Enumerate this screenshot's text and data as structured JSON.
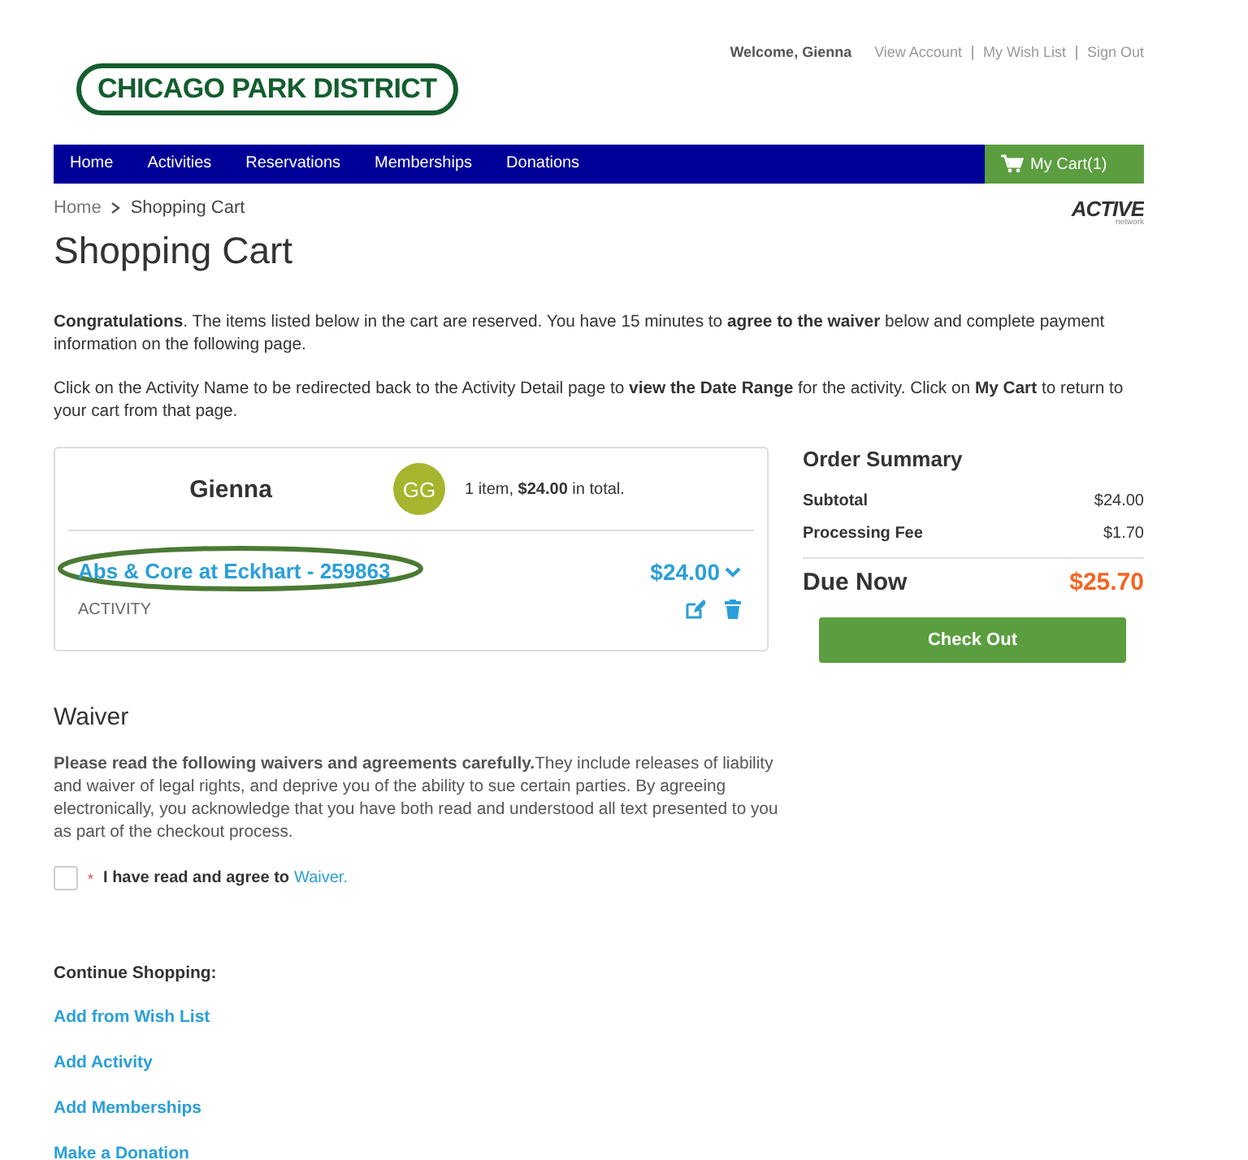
{
  "header": {
    "logo": "CHICAGO PARK DISTRICT",
    "welcome": "Welcome, Gienna",
    "links": [
      "View Account",
      "My Wish List",
      "Sign Out"
    ]
  },
  "nav": {
    "items": [
      "Home",
      "Activities",
      "Reservations",
      "Memberships",
      "Donations"
    ],
    "cart": "My Cart(1)"
  },
  "breadcrumb": [
    "Home",
    "Shopping Cart"
  ],
  "brand": {
    "name": "ACTIVE",
    "sub": "network"
  },
  "title": "Shopping Cart",
  "intro": [
    "**Congratulations**. The items listed below in the cart are reserved. You have 15 minutes to **agree to the waiver** below and complete payment information on the following page.",
    "Click on the Activity Name to be redirected back to the Activity Detail page to **view the Date Range** for the activity. Click on **My Cart** to return to your cart from that page."
  ],
  "cart": {
    "person": "Gienna",
    "initials": "GG",
    "summary": "1 item, **$24.00** in total.",
    "items": [
      {
        "name": "Abs & Core at Eckhart - 259863",
        "price": "$24.00",
        "type": "ACTIVITY",
        "highlighted": true
      }
    ]
  },
  "order_summary": {
    "title": "Order Summary",
    "lines": [
      {
        "label": "Subtotal",
        "value": "$24.00"
      },
      {
        "label": "Processing Fee",
        "value": "$1.70"
      }
    ],
    "due_label": "Due Now",
    "due_value": "$25.70",
    "button": "Check Out"
  },
  "waiver": {
    "title": "Waiver",
    "text": "**Please read the following waivers and agreements carefully.**They include releases of liability and waiver of legal rights, and deprive you of the ability to sue certain parties. By agreeing electronically, you acknowledge that you have both read and understood all text presented to you as part of the checkout process.",
    "required_mark": "*",
    "agree_label": "I have read and agree to",
    "agree_link": "Waiver.",
    "checked": false
  },
  "continue": {
    "title": "Continue Shopping:",
    "links": [
      "Add from Wish List",
      "Add Activity",
      "Add Memberships",
      "Make a Donation"
    ]
  }
}
